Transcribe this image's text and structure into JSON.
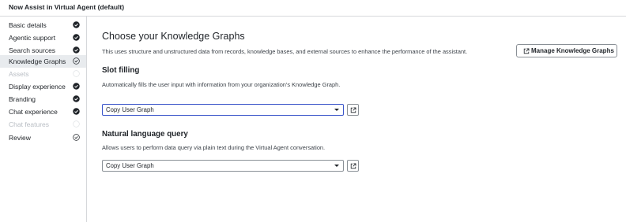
{
  "app": {
    "title": "Now Assist in Virtual Agent (default)"
  },
  "sidebar": {
    "items": [
      {
        "label": "Basic details",
        "status": "complete"
      },
      {
        "label": "Agentic support",
        "status": "complete"
      },
      {
        "label": "Search sources",
        "status": "complete"
      },
      {
        "label": "Knowledge Graphs",
        "status": "in-progress"
      },
      {
        "label": "Assets",
        "status": "disabled"
      },
      {
        "label": "Display experience",
        "status": "complete"
      },
      {
        "label": "Branding",
        "status": "complete"
      },
      {
        "label": "Chat experience",
        "status": "complete"
      },
      {
        "label": "Chat features",
        "status": "disabled"
      },
      {
        "label": "Review",
        "status": "in-progress"
      }
    ]
  },
  "main": {
    "title": "Choose your Knowledge Graphs",
    "description": "This uses structure and unstructured data from records, knowledge bases, and external sources to enhance the performance of the assistant.",
    "manage_button": "Manage Knowledge Graphs",
    "slot_filling": {
      "title": "Slot filling",
      "description": "Automatically fills the user input with information from your organization's Knowledge Graph.",
      "selected": "Copy User Graph"
    },
    "nlq": {
      "title": "Natural language query",
      "description": "Allows users to perform data query via plain text during the Virtual Agent conversation.",
      "selected": "Copy User Graph"
    }
  },
  "icons": {
    "complete": "check-circle-icon",
    "in_progress": "progress-circle-icon",
    "disabled": "empty-circle-icon",
    "open": "open-external-icon"
  },
  "colors": {
    "focus": "#3a55c9",
    "active_bg": "#e8ebee",
    "disabled_text": "#b9bec4"
  }
}
